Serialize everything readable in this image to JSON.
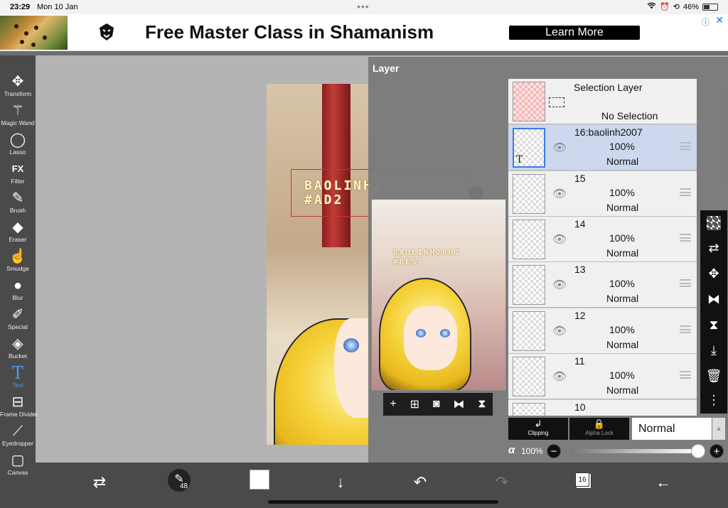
{
  "status": {
    "time": "23:29",
    "date": "Mon 10 Jan",
    "battery": "46%",
    "battery_level": 0.46
  },
  "ad": {
    "headline": "Free Master Class in Shamanism",
    "cta": "Learn More"
  },
  "tools": [
    {
      "label": "Transform",
      "icon": "move-icon"
    },
    {
      "label": "Magic Wand",
      "icon": "magic-wand-icon"
    },
    {
      "label": "Lasso",
      "icon": "lasso-icon"
    },
    {
      "label": "Filter",
      "icon": "fx-icon"
    },
    {
      "label": "Brush",
      "icon": "brush-icon"
    },
    {
      "label": "Eraser",
      "icon": "eraser-icon"
    },
    {
      "label": "Smudge",
      "icon": "smudge-icon"
    },
    {
      "label": "Blur",
      "icon": "blur-drop-icon"
    },
    {
      "label": "Special",
      "icon": "special-wand-icon"
    },
    {
      "label": "Bucket",
      "icon": "bucket-icon"
    },
    {
      "label": "Text",
      "icon": "text-icon",
      "active": true
    },
    {
      "label": "Frame Divider",
      "icon": "frame-divider-icon"
    },
    {
      "label": "Eyedropper",
      "icon": "eyedropper-icon"
    },
    {
      "label": "Canvas",
      "icon": "canvas-icon"
    }
  ],
  "canvas": {
    "text_line1": "BAOLINH2007",
    "text_line2": "#AD2",
    "preview_line1": "BAOLINH2007",
    "preview_line2": "#REST"
  },
  "layer_panel": {
    "title": "Layer",
    "selection_layer": {
      "name": "Selection Layer",
      "status": "No Selection"
    },
    "layers": [
      {
        "name": "16:baolinh2007",
        "opacity": "100%",
        "blend": "Normal",
        "selected": true
      },
      {
        "name": "15",
        "opacity": "100%",
        "blend": "Normal"
      },
      {
        "name": "14",
        "opacity": "100%",
        "blend": "Normal"
      },
      {
        "name": "13",
        "opacity": "100%",
        "blend": "Normal"
      },
      {
        "name": "12",
        "opacity": "100%",
        "blend": "Normal"
      },
      {
        "name": "11",
        "opacity": "100%",
        "blend": "Normal"
      },
      {
        "name": "10"
      }
    ],
    "clipping_label": "Clipping",
    "alpha_lock_label": "Alpha Lock",
    "blend_mode": "Normal",
    "alpha_symbol": "α",
    "alpha_value": "100%",
    "alpha_level": 1.0
  },
  "bottom": {
    "brush_size": "48",
    "layer_count": "16"
  }
}
